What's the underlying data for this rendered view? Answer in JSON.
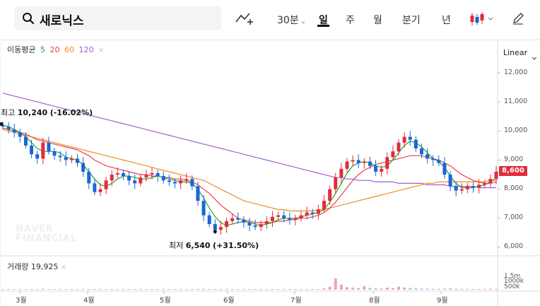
{
  "header": {
    "search_query": "새로닉스",
    "intervals": [
      "30분",
      "일",
      "주",
      "월",
      "분기",
      "년"
    ],
    "selected_interval": "일",
    "interval_dropdown_mark": "⌄"
  },
  "legend": {
    "label": "이동평균",
    "periods": [
      {
        "value": "5",
        "color": "#1aa537"
      },
      {
        "value": "20",
        "color": "#e8424c"
      },
      {
        "value": "60",
        "color": "#f08a24"
      },
      {
        "value": "120",
        "color": "#a060d0"
      }
    ],
    "close_mark": "×"
  },
  "scale_label": "Linear",
  "volume": {
    "label": "거래량",
    "value": "19,925",
    "close_mark": "×",
    "ticks": [
      "1.5m",
      "1000k",
      "500k"
    ]
  },
  "chart_data": {
    "type": "candlestick",
    "y_ticks": [
      "12,000",
      "11,000",
      "10,000",
      "9,000",
      "8,000",
      "7,000",
      "6,000"
    ],
    "y_tick_values": [
      12000,
      11000,
      10000,
      9000,
      8000,
      7000,
      6000
    ],
    "x_ticks": [
      "3월",
      "4월",
      "5월",
      "6월",
      "7월",
      "8월",
      "9월"
    ],
    "current_price": "8,600",
    "annotations": {
      "high": {
        "prefix": "최고",
        "value": "10,240",
        "change": "(-16.02%)"
      },
      "low": {
        "prefix": "최저",
        "value": "6,540",
        "change": "(+31.50%)"
      }
    },
    "close_series": [
      10150,
      10050,
      9950,
      9800,
      9500,
      9200,
      9050,
      9600,
      9300,
      9150,
      9100,
      9000,
      9050,
      8900,
      8600,
      8200,
      7900,
      8000,
      8300,
      8500,
      8550,
      8450,
      8300,
      8200,
      8400,
      8500,
      8550,
      8450,
      8300,
      8250,
      8200,
      8300,
      8350,
      8100,
      7600,
      7100,
      6800,
      6600,
      6700,
      6900,
      7000,
      6950,
      6850,
      6750,
      6700,
      6800,
      6900,
      7050,
      7100,
      7000,
      6950,
      7000,
      7100,
      7200,
      7150,
      7300,
      7600,
      8000,
      8400,
      8700,
      8950,
      9000,
      8900,
      8950,
      8800,
      8600,
      8700,
      9100,
      9300,
      9600,
      9800,
      9700,
      9400,
      9200,
      9050,
      9000,
      8900,
      8500,
      8100,
      7950,
      8000,
      8100,
      8050,
      8150,
      8200,
      8350,
      8600
    ],
    "ma5": [
      10200,
      10150,
      10050,
      9950,
      9800,
      9600,
      9400,
      9300,
      9300,
      9300,
      9250,
      9100,
      9050,
      9000,
      8850,
      8600,
      8350,
      8150,
      8100,
      8200,
      8350,
      8450,
      8450,
      8400,
      8350,
      8350,
      8400,
      8450,
      8400,
      8350,
      8300,
      8250,
      8250,
      8200,
      8000,
      7700,
      7350,
      7050,
      6850,
      6750,
      6800,
      6850,
      6900,
      6850,
      6800,
      6750,
      6800,
      6850,
      6950,
      7000,
      7000,
      7000,
      7050,
      7100,
      7150,
      7200,
      7300,
      7550,
      7850,
      8200,
      8550,
      8800,
      8900,
      8950,
      8900,
      8800,
      8750,
      8800,
      9000,
      9250,
      9500,
      9650,
      9600,
      9450,
      9250,
      9050,
      8950,
      8750,
      8450,
      8200,
      8050,
      8050,
      8050,
      8100,
      8150,
      8250,
      8400
    ],
    "ma20": [
      10100,
      10050,
      10000,
      9950,
      9900,
      9800,
      9700,
      9650,
      9600,
      9550,
      9500,
      9450,
      9400,
      9350,
      9250,
      9150,
      9000,
      8900,
      8800,
      8750,
      8700,
      8650,
      8600,
      8550,
      8500,
      8500,
      8450,
      8450,
      8400,
      8400,
      8350,
      8350,
      8300,
      8250,
      8150,
      8000,
      7850,
      7650,
      7450,
      7300,
      7150,
      7000,
      6950,
      6900,
      6850,
      6850,
      6850,
      6850,
      6900,
      6900,
      6950,
      6950,
      7000,
      7000,
      7050,
      7100,
      7200,
      7350,
      7550,
      7800,
      8050,
      8300,
      8500,
      8650,
      8750,
      8850,
      8900,
      8950,
      9000,
      9050,
      9100,
      9150,
      9150,
      9150,
      9100,
      9050,
      9000,
      8900,
      8800,
      8650,
      8500,
      8400,
      8300,
      8250,
      8200,
      8200,
      8250
    ],
    "ma60": [
      10050,
      10000,
      9950,
      9900,
      9850,
      9800,
      9750,
      9700,
      9650,
      9600,
      9550,
      9500,
      9450,
      9400,
      9350,
      9300,
      9250,
      9200,
      9150,
      9100,
      9050,
      9000,
      8950,
      8900,
      8850,
      8800,
      8750,
      8700,
      8650,
      8600,
      8550,
      8500,
      8450,
      8400,
      8350,
      8300,
      8200,
      8100,
      8000,
      7900,
      7800,
      7700,
      7600,
      7550,
      7500,
      7450,
      7400,
      7350,
      7300,
      7300,
      7250,
      7250,
      7250,
      7250,
      7250,
      7300,
      7300,
      7350,
      7400,
      7450,
      7500,
      7550,
      7600,
      7650,
      7700,
      7750,
      7800,
      7850,
      7900,
      7950,
      8000,
      8050,
      8100,
      8150,
      8200,
      8200,
      8250,
      8250,
      8250,
      8250,
      8250,
      8250,
      8250,
      8250,
      8250,
      8300,
      8300
    ],
    "ma120": [
      11300,
      11250,
      11200,
      11150,
      11100,
      11050,
      11000,
      10950,
      10900,
      10850,
      10800,
      10750,
      10700,
      10650,
      10600,
      10550,
      10500,
      10450,
      10400,
      10350,
      10300,
      10250,
      10200,
      10150,
      10100,
      10050,
      10000,
      9950,
      9900,
      9850,
      9800,
      9750,
      9700,
      9650,
      9600,
      9550,
      9500,
      9450,
      9400,
      9350,
      9300,
      9250,
      9200,
      9150,
      9100,
      9050,
      9000,
      8950,
      8900,
      8850,
      8800,
      8750,
      8700,
      8650,
      8600,
      8550,
      8500,
      8450,
      8400,
      8400,
      8350,
      8350,
      8300,
      8300,
      8300,
      8250,
      8250,
      8250,
      8250,
      8200,
      8200,
      8200,
      8200,
      8200,
      8150,
      8150,
      8150,
      8150,
      8100,
      8100,
      8100,
      8100,
      8100,
      8050,
      8050,
      8050,
      8050
    ],
    "volume_series": [
      60,
      50,
      40,
      45,
      70,
      55,
      40,
      90,
      50,
      40,
      35,
      30,
      35,
      40,
      50,
      60,
      70,
      40,
      35,
      40,
      30,
      30,
      25,
      30,
      35,
      30,
      30,
      25,
      25,
      30,
      25,
      30,
      30,
      40,
      80,
      90,
      70,
      40,
      35,
      30,
      30,
      25,
      25,
      25,
      20,
      25,
      25,
      30,
      30,
      25,
      20,
      25,
      30,
      30,
      25,
      40,
      120,
      300,
      1100,
      500,
      250,
      200,
      150,
      350,
      180,
      140,
      120,
      200,
      160,
      300,
      220,
      180,
      140,
      120,
      100,
      90,
      80,
      110,
      130,
      90,
      80,
      70,
      60,
      70,
      80,
      90,
      60
    ]
  }
}
